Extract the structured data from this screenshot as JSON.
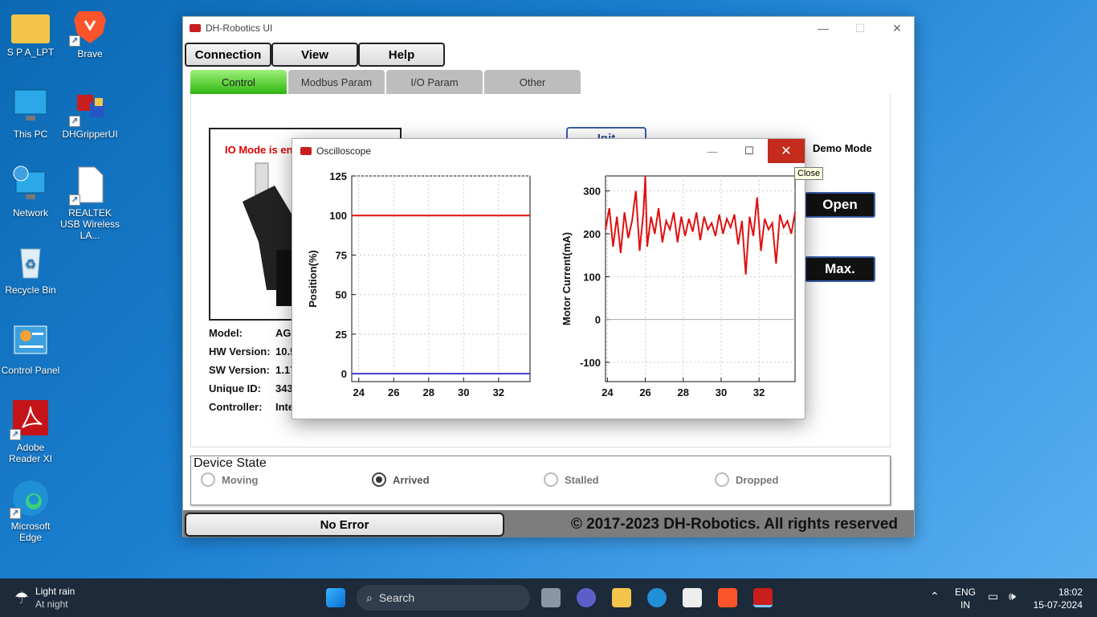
{
  "desktop": {
    "icons": [
      {
        "label": "S P A_LPT"
      },
      {
        "label": "Brave"
      },
      {
        "label": "This PC"
      },
      {
        "label": "DHGripperUI"
      },
      {
        "label": "Network"
      },
      {
        "label": "REALTEK USB Wireless LA..."
      },
      {
        "label": "Recycle Bin"
      },
      {
        "label": "Control Panel"
      },
      {
        "label": "Adobe Reader XI"
      },
      {
        "label": "Microsoft Edge"
      }
    ]
  },
  "app": {
    "title": "DH-Robotics UI",
    "menu": {
      "connection": "Connection",
      "view": "View",
      "help": "Help"
    },
    "tabs": [
      "Control",
      "Modbus Param",
      "I/O Param",
      "Other"
    ],
    "io_mode_text": "IO Mode is en",
    "info": {
      "model_label": "Model:",
      "model_value": "AG",
      "hw_label": "HW Version:",
      "hw_value": "10.5",
      "sw_label": "SW Version:",
      "sw_value": "1.17",
      "uid_label": "Unique ID:",
      "uid_value": "343",
      "ctrl_label": "Controller:",
      "ctrl_value": "Inte"
    },
    "init_label": "Init",
    "demo_mode": "Demo Mode",
    "open_label": "Open",
    "max_label": "Max.",
    "device_state": {
      "title": "Device State",
      "states": [
        "Moving",
        "Arrived",
        "Stalled",
        "Dropped"
      ],
      "selected": "Arrived"
    },
    "status": "No Error",
    "copyright": "© 2017-2023 DH-Robotics. All rights reserved"
  },
  "oscilloscope": {
    "title": "Oscilloscope",
    "tooltip": "Close"
  },
  "chart_data": [
    {
      "type": "line",
      "ylabel": "Position(%)",
      "xlim": [
        23.6,
        33.8
      ],
      "ylim": [
        -5,
        125
      ],
      "xticks": [
        24,
        26,
        28,
        30,
        32
      ],
      "yticks": [
        0,
        25,
        50,
        75,
        100,
        125
      ],
      "grid": true,
      "series": [
        {
          "color": "#e01010",
          "x": [
            23.6,
            33.8
          ],
          "y": [
            100,
            100
          ]
        },
        {
          "color": "#3b3bd0",
          "x": [
            23.6,
            33.8
          ],
          "y": [
            0,
            0
          ]
        }
      ]
    },
    {
      "type": "line",
      "ylabel": "Motor Current(mA)",
      "xlim": [
        23.9,
        33.9
      ],
      "ylim": [
        -145,
        335
      ],
      "xticks": [
        24,
        26,
        28,
        30,
        32
      ],
      "yticks": [
        -100,
        0,
        100,
        200,
        300
      ],
      "grid": true,
      "series": [
        {
          "color": "#e01010",
          "x": [
            23.9,
            24.1,
            24.3,
            24.5,
            24.7,
            24.9,
            25.1,
            25.3,
            25.5,
            25.7,
            25.9,
            26.0,
            26.1,
            26.3,
            26.5,
            26.7,
            26.9,
            27.1,
            27.3,
            27.5,
            27.7,
            27.9,
            28.1,
            28.3,
            28.5,
            28.7,
            28.9,
            29.1,
            29.3,
            29.5,
            29.7,
            29.9,
            30.1,
            30.3,
            30.5,
            30.7,
            30.9,
            31.1,
            31.3,
            31.5,
            31.7,
            31.9,
            32.1,
            32.3,
            32.5,
            32.7,
            32.9,
            33.1,
            33.3,
            33.5,
            33.7,
            33.9
          ],
          "y": [
            210,
            260,
            170,
            240,
            155,
            250,
            190,
            230,
            300,
            160,
            250,
            335,
            170,
            240,
            200,
            260,
            180,
            230,
            210,
            250,
            180,
            240,
            195,
            235,
            205,
            250,
            185,
            240,
            210,
            225,
            195,
            245,
            200,
            235,
            215,
            245,
            175,
            230,
            105,
            240,
            195,
            285,
            160,
            235,
            210,
            225,
            130,
            245,
            215,
            230,
            200,
            250
          ]
        }
      ]
    }
  ],
  "taskbar": {
    "weather_line1": "Light rain",
    "weather_line2": "At night",
    "search": "Search",
    "lang1": "ENG",
    "lang2": "IN",
    "time": "18:02",
    "date": "15-07-2024"
  }
}
